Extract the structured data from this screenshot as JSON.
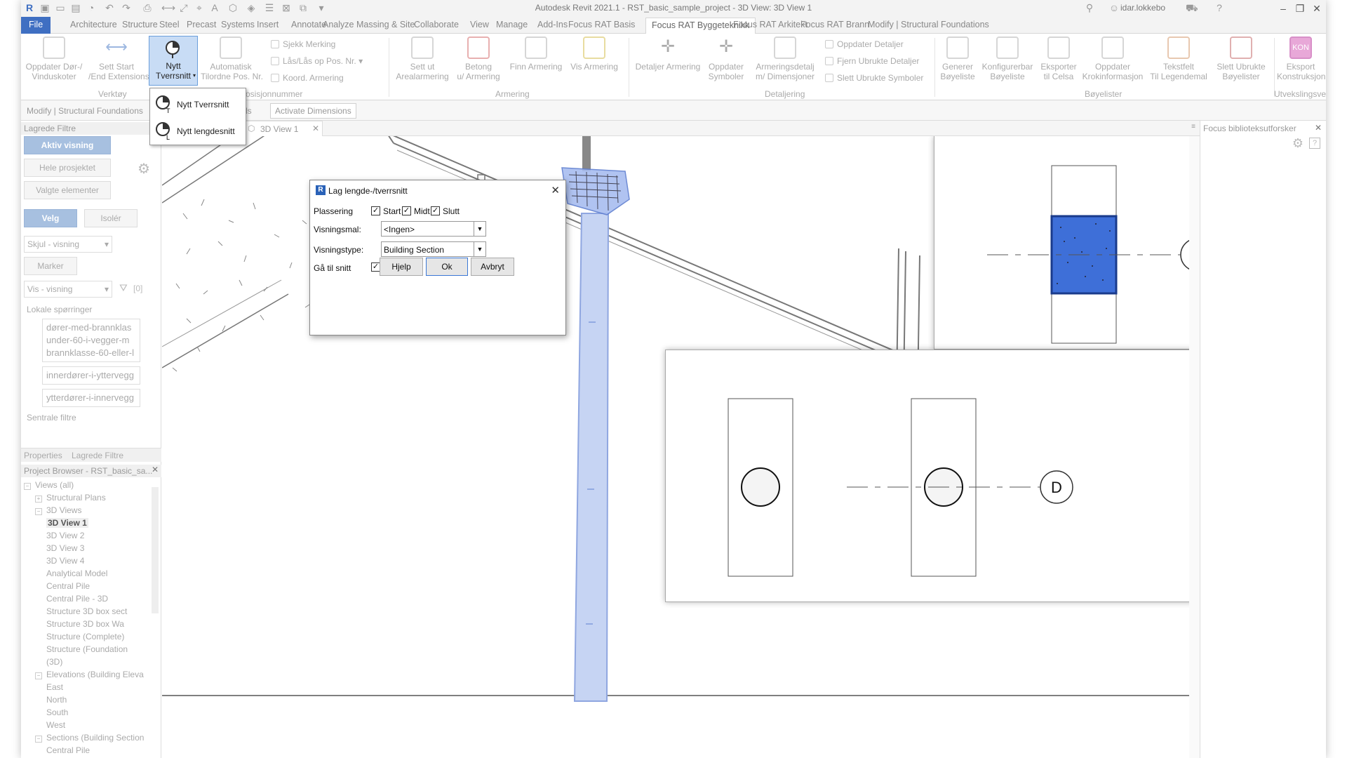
{
  "app": {
    "title": "Autodesk Revit 2021.1 - RST_basic_sample_project - 3D View: 3D View 1",
    "user": "idar.lokkebo"
  },
  "menu_tabs": [
    "File",
    "Architecture",
    "Structure",
    "Steel",
    "Precast",
    "Systems",
    "Insert",
    "Annotate",
    "Analyze",
    "Massing & Site",
    "Collaborate",
    "View",
    "Manage",
    "Add-Ins",
    "Focus RAT Basis",
    "Focus RAT Byggeteknikk",
    "Focus RAT Arkitekt",
    "Focus RAT Brann",
    "Modify | Structural Foundations"
  ],
  "ribbon": {
    "oppdater_dor": "Oppdater Dør-/\nVinduskoter",
    "sett_start": "Sett Start\n/End Extensions",
    "nytt_tverrsnitt": "Nytt\nTverrsnitt",
    "automatisk": "Automatisk\nTilordne Pos. Nr.",
    "sjekk_merking": "Sjekk Merking",
    "las_pos": "Lås/Lås op  Pos. Nr.",
    "koord_armering": "Koord. Armering",
    "sett_ut": "Sett ut\nArealarmering",
    "betong": "Betong\nu/ Armering",
    "finn_armering": "Finn Armering",
    "vis_armering": "Vis Armering",
    "detaljer_armering": "Detaljer Armering",
    "oppdater_symboler": "Oppdater\nSymboler",
    "armeringsdetalj": "Armeringsdetalj\nm/ Dimensjoner",
    "oppdater_detaljer": "Oppdater  Detaljer",
    "fjern_ubrukte": "Fjern Ubrukte  Detaljer",
    "slett_ubrukte_symboler": "Slett Ubrukte  Symboler",
    "generer": "Generer\nBøyeliste",
    "konfigurerbar": "Konfigurerbar\nBøyeliste",
    "eksporter_celsa": "Eksporter\ntil Celsa",
    "oppdater_krok": "Oppdater\nKrokinformasjon",
    "tekstfelt": "Tekstfelt\nTil Legendemal",
    "slett_boyelister": "Slett Ubrukte\nBøyelister",
    "eksport_konstruksjon": "Eksport\nKonstruksjon",
    "panels": {
      "verktoy": "Verktøy",
      "posisjonnummer": "Posisjonnummer",
      "armering": "Armering",
      "detaljering": "Detaljering",
      "boyelister": "Bøyelister",
      "utveksling": "Utvekslingsverktøy"
    }
  },
  "options_bar": {
    "context": "Modify | Structural Foundations",
    "activate_dimensions": "Activate Dimensions",
    "partial": "ds"
  },
  "dropdown": {
    "item1": "Nytt  Tverrsnitt",
    "item2": "Nytt  lengdesnitt"
  },
  "left_panel": {
    "header": "Lagrede Filtre",
    "aktiv_visning": "Aktiv visning",
    "hele_prosjektet": "Hele prosjektet",
    "valgte_elementer": "Valgte elementer",
    "velg": "Velg",
    "isoler": "Isolér",
    "skjul": "Skjul - visning",
    "marker": "Marker",
    "vis": "Vis - visning",
    "filter_count": "[0]",
    "lokale": "Lokale spørringer",
    "query1": [
      "dører-med-brannklas",
      "under-60-i-vegger-m",
      "brannklasse-60-eller-l"
    ],
    "query2": "innerdører-i-yttervegg",
    "query3": "ytterdører-i-innervegg",
    "sentrale": "Sentrale filtre",
    "tab_properties": "Properties",
    "tab_lagrede": "Lagrede Filtre",
    "browser_title": "Project Browser - RST_basic_sa..."
  },
  "tree": [
    {
      "label": "Views (all)",
      "level": 0,
      "exp": "−"
    },
    {
      "label": "Structural Plans",
      "level": 1,
      "exp": "+"
    },
    {
      "label": "3D Views",
      "level": 1,
      "exp": "−"
    },
    {
      "label": "3D View 1",
      "level": 2,
      "sel": true
    },
    {
      "label": "3D View 2",
      "level": 2
    },
    {
      "label": "3D View 3",
      "level": 2
    },
    {
      "label": "3D View 4",
      "level": 2
    },
    {
      "label": "Analytical Model",
      "level": 2
    },
    {
      "label": "Central Pile",
      "level": 2
    },
    {
      "label": "Central Pile - 3D",
      "level": 2
    },
    {
      "label": "Structure 3D box sect",
      "level": 2
    },
    {
      "label": "Structure 3D box Wa",
      "level": 2
    },
    {
      "label": "Structure (Complete)",
      "level": 2
    },
    {
      "label": "Structure (Foundation",
      "level": 2
    },
    {
      "label": "(3D)",
      "level": 2
    },
    {
      "label": "Elevations (Building Eleva",
      "level": 1,
      "exp": "−"
    },
    {
      "label": "East",
      "level": 2
    },
    {
      "label": "North",
      "level": 2
    },
    {
      "label": "South",
      "level": 2
    },
    {
      "label": "West",
      "level": 2
    },
    {
      "label": "Sections (Building Section",
      "level": 1,
      "exp": "−"
    },
    {
      "label": "Central Pile",
      "level": 2
    }
  ],
  "view_tab": "3D View 1",
  "right_panel": {
    "title": "Focus biblioteksutforsker"
  },
  "dialog": {
    "title": "Lag lengde-/tverrsnitt",
    "logo": "R",
    "plassering": "Plassering",
    "start": "Start",
    "midt": "Midt",
    "slutt": "Slutt",
    "visningsmal_label": "Visningsmal:",
    "visningsmal_value": "<Ingen>",
    "visningstype_label": "Visningstype:",
    "visningstype_value": "Building Section",
    "ga_til_snitt": "Gå til snitt",
    "hjelp": "Hjelp",
    "ok": "Ok",
    "avbryt": "Avbryt"
  },
  "sections": {
    "tag1": "D",
    "tag2": "D"
  },
  "colors": {
    "accent": "#3f6fc2",
    "selection": "#c8dcf5",
    "foundation": "#3e6fd8",
    "pile": "#c6d4f3"
  }
}
